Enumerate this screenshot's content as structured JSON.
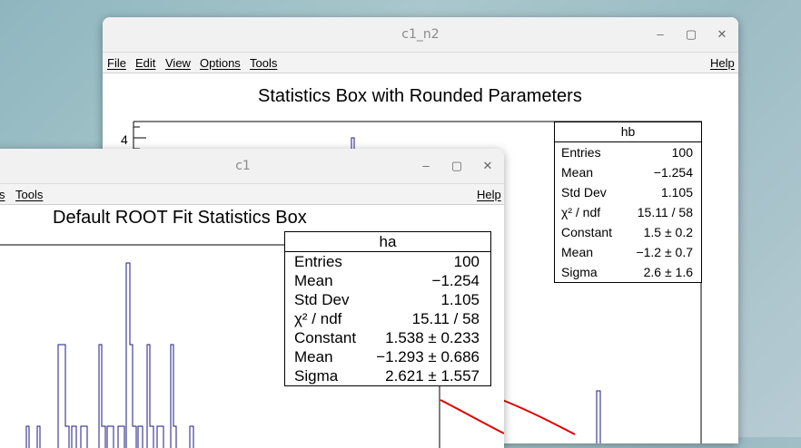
{
  "back_window": {
    "title": "c1_n2",
    "menu": [
      "File",
      "Edit",
      "View",
      "Options",
      "Tools"
    ],
    "help": "Help",
    "plot_title": "Statistics Box with Rounded Parameters",
    "y_tick": "4",
    "stats": {
      "name": "hb",
      "rows": [
        {
          "label": "Entries",
          "value": "100"
        },
        {
          "label": "Mean",
          "value": "−1.254"
        },
        {
          "label": "Std Dev",
          "value": "1.105"
        },
        {
          "label": "χ² / ndf",
          "value": "15.11 / 58"
        },
        {
          "label": "Constant",
          "value": "1.5 ± 0.2"
        },
        {
          "label": "Mean",
          "value": "−1.2 ± 0.7"
        },
        {
          "label": "Sigma",
          "value": "2.6 ± 1.6"
        }
      ]
    }
  },
  "front_window": {
    "title": "c1",
    "menu": [
      "s",
      "Tools"
    ],
    "help": "Help",
    "plot_title": "Default ROOT Fit Statistics Box",
    "stats": {
      "name": "ha",
      "rows": [
        {
          "label": "Entries",
          "value": "100"
        },
        {
          "label": "Mean",
          "value": "−1.254"
        },
        {
          "label": "Std Dev",
          "value": "1.105"
        },
        {
          "label": "χ² / ndf",
          "value": "15.11 / 58"
        },
        {
          "label": "Constant",
          "value": "1.538 ± 0.233"
        },
        {
          "label": "Mean",
          "value": "−1.293 ± 0.686"
        },
        {
          "label": "Sigma",
          "value": "2.621 ± 1.557"
        }
      ]
    }
  },
  "window_controls": {
    "minimize": "–",
    "maximize": "▢",
    "close": "✕"
  },
  "colors": {
    "histogram": "#1a1a80",
    "fit": "#e00000"
  }
}
